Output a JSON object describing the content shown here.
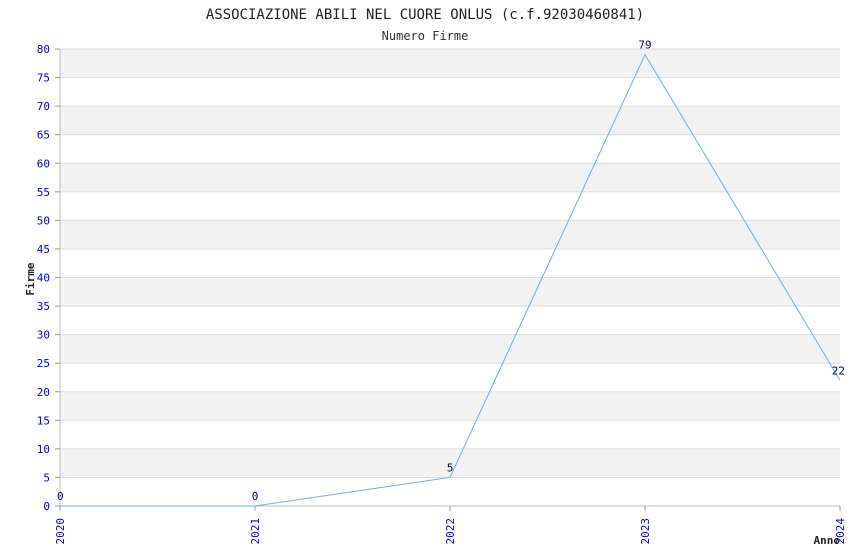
{
  "chart_data": {
    "type": "line",
    "title": "ASSOCIAZIONE ABILI NEL CUORE ONLUS (c.f.92030460841)",
    "subtitle": "Numero Firme",
    "xlabel": "Anno",
    "ylabel": "Firme",
    "x": [
      "2020",
      "2021",
      "2022",
      "2023",
      "2024"
    ],
    "series": [
      {
        "values": [
          0,
          0,
          5,
          79,
          22
        ]
      }
    ],
    "ylim": [
      0,
      80
    ],
    "ytick_step": 5,
    "grid": true,
    "colors": {
      "line": "#6aaee8",
      "tick_text": "#0000cc",
      "band": "#f2f2f2",
      "grid": "#dddddd",
      "label_text": "#000066"
    }
  }
}
